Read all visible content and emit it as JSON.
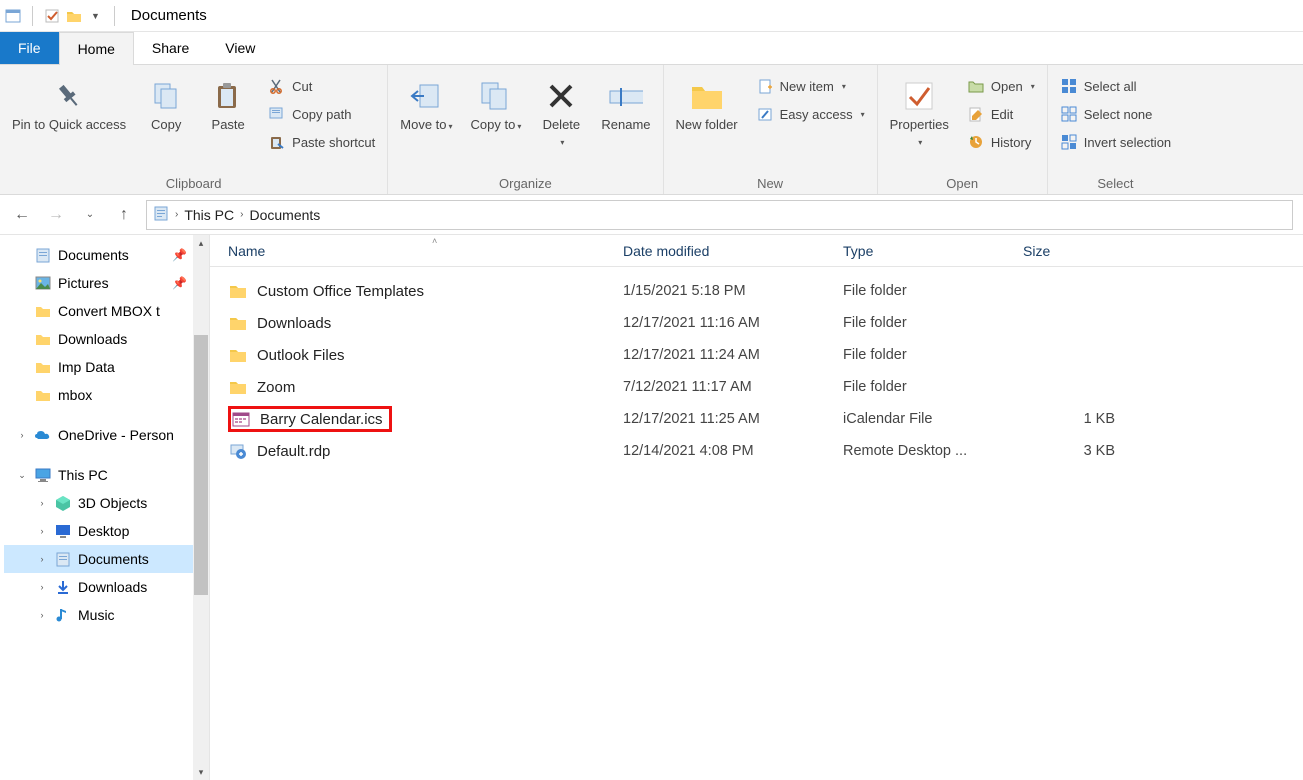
{
  "window": {
    "title": "Documents"
  },
  "tabs": {
    "file": "File",
    "home": "Home",
    "share": "Share",
    "view": "View"
  },
  "ribbon": {
    "clipboard": {
      "label": "Clipboard",
      "pin": "Pin to Quick access",
      "copy": "Copy",
      "paste": "Paste",
      "cut": "Cut",
      "copypath": "Copy path",
      "pasteshortcut": "Paste shortcut"
    },
    "organize": {
      "label": "Organize",
      "moveto": "Move to",
      "copyto": "Copy to",
      "delete": "Delete",
      "rename": "Rename"
    },
    "new": {
      "label": "New",
      "newfolder": "New folder",
      "newitem": "New item",
      "easyaccess": "Easy access"
    },
    "open": {
      "label": "Open",
      "properties": "Properties",
      "open": "Open",
      "edit": "Edit",
      "history": "History"
    },
    "select": {
      "label": "Select",
      "selectall": "Select all",
      "selectnone": "Select none",
      "invert": "Invert selection"
    }
  },
  "breadcrumb": {
    "a": "This PC",
    "b": "Documents"
  },
  "navpane": {
    "quick": {
      "documents": "Documents",
      "pictures": "Pictures",
      "convertmbox": "Convert MBOX t",
      "downloads": "Downloads",
      "impdata": "Imp Data",
      "mbox": "mbox"
    },
    "onedrive": "OneDrive - Person",
    "thispc": {
      "label": "This PC",
      "objects3d": "3D Objects",
      "desktop": "Desktop",
      "documents": "Documents",
      "downloads": "Downloads",
      "music": "Music"
    }
  },
  "columns": {
    "name": "Name",
    "date": "Date modified",
    "type": "Type",
    "size": "Size"
  },
  "files": [
    {
      "name": "Custom Office Templates",
      "date": "1/15/2021 5:18 PM",
      "type": "File folder",
      "size": "",
      "icon": "folder",
      "hl": false
    },
    {
      "name": "Downloads",
      "date": "12/17/2021 11:16 AM",
      "type": "File folder",
      "size": "",
      "icon": "folder",
      "hl": false
    },
    {
      "name": "Outlook Files",
      "date": "12/17/2021 11:24 AM",
      "type": "File folder",
      "size": "",
      "icon": "folder",
      "hl": false
    },
    {
      "name": "Zoom",
      "date": "7/12/2021 11:17 AM",
      "type": "File folder",
      "size": "",
      "icon": "folder",
      "hl": false
    },
    {
      "name": "Barry Calendar.ics",
      "date": "12/17/2021 11:25 AM",
      "type": "iCalendar File",
      "size": "1 KB",
      "icon": "ics",
      "hl": true
    },
    {
      "name": "Default.rdp",
      "date": "12/14/2021 4:08 PM",
      "type": "Remote Desktop ...",
      "size": "3 KB",
      "icon": "rdp",
      "hl": false
    }
  ]
}
